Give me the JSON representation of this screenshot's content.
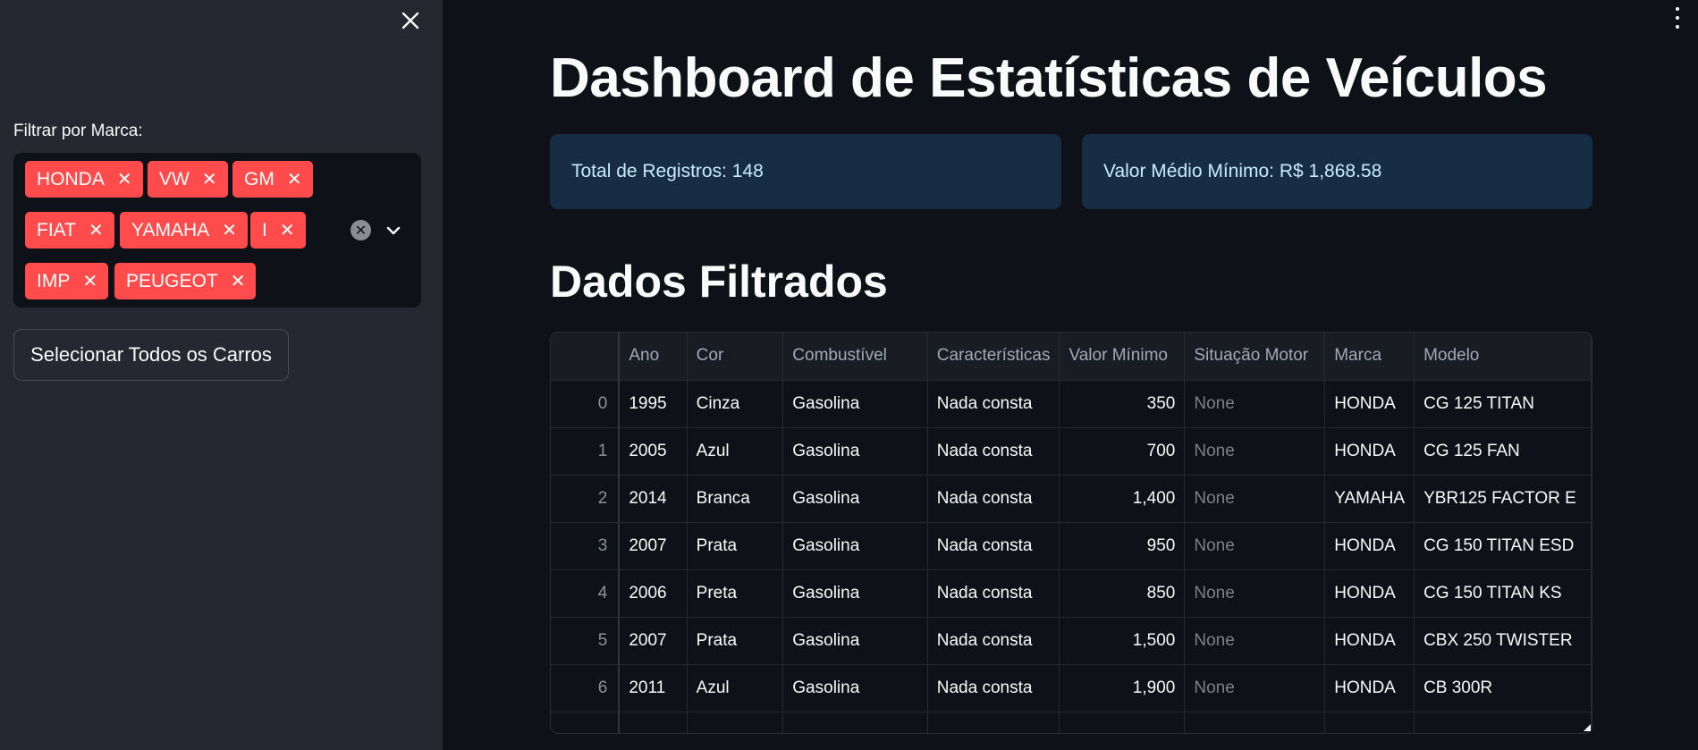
{
  "sidebar": {
    "filter_label": "Filtrar por Marca:",
    "chips": [
      {
        "label": "HONDA"
      },
      {
        "label": "VW"
      },
      {
        "label": "GM"
      },
      {
        "label": "FIAT"
      },
      {
        "label": "YAMAHA"
      },
      {
        "label": "I"
      },
      {
        "label": "IMP"
      },
      {
        "label": "PEUGEOT"
      }
    ],
    "select_all_label": "Selecionar Todos os Carros",
    "chip_color": "#ff4b4b"
  },
  "main": {
    "title": "Dashboard de Estatísticas de Veículos",
    "stats": {
      "total": "Total de Registros: 148",
      "avg": "Valor Médio Mínimo: R$ 1,868.58"
    },
    "section_title": "Dados Filtrados",
    "table": {
      "columns": [
        "",
        "Ano",
        "Cor",
        "Combustível",
        "Características",
        "Valor Mínimo",
        "Situação Motor",
        "Marca",
        "Modelo"
      ],
      "rows": [
        [
          "0",
          "1995",
          "Cinza",
          "Gasolina",
          "Nada consta",
          "350",
          "None",
          "HONDA",
          "CG 125 TITAN"
        ],
        [
          "1",
          "2005",
          "Azul",
          "Gasolina",
          "Nada consta",
          "700",
          "None",
          "HONDA",
          "CG 125 FAN"
        ],
        [
          "2",
          "2014",
          "Branca",
          "Gasolina",
          "Nada consta",
          "1,400",
          "None",
          "YAMAHA",
          "YBR125 FACTOR E"
        ],
        [
          "3",
          "2007",
          "Prata",
          "Gasolina",
          "Nada consta",
          "950",
          "None",
          "HONDA",
          "CG 150 TITAN ESD"
        ],
        [
          "4",
          "2006",
          "Preta",
          "Gasolina",
          "Nada consta",
          "850",
          "None",
          "HONDA",
          "CG 150 TITAN KS"
        ],
        [
          "5",
          "2007",
          "Prata",
          "Gasolina",
          "Nada consta",
          "1,500",
          "None",
          "HONDA",
          "CBX 250 TWISTER"
        ],
        [
          "6",
          "2011",
          "Azul",
          "Gasolina",
          "Nada consta",
          "1,900",
          "None",
          "HONDA",
          "CB 300R"
        ]
      ]
    }
  },
  "icons": {
    "close": "close-icon",
    "clear": "clear-all-icon",
    "chevron": "chevron-down-icon",
    "menu": "kebab-menu-icon"
  }
}
